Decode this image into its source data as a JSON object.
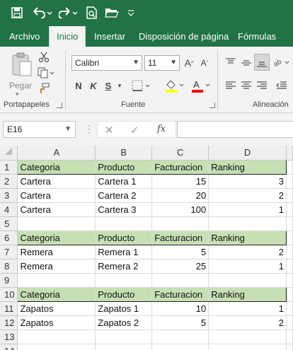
{
  "qat": {
    "icons": [
      "save-icon",
      "undo-icon",
      "redo-icon",
      "print-preview-icon",
      "open-folder-icon",
      "customize-qat-icon"
    ]
  },
  "tabs": [
    {
      "label": "Archivo"
    },
    {
      "label": "Inicio"
    },
    {
      "label": "Insertar"
    },
    {
      "label": "Disposición de página"
    },
    {
      "label": "Fórmulas"
    }
  ],
  "ribbon": {
    "clipboard": {
      "paste_label": "Pegar",
      "group_label": "Portapapeles"
    },
    "font": {
      "font_name": "Calibri",
      "font_size": "11",
      "bold": "N",
      "italic": "K",
      "underline": "S",
      "group_label": "Fuente",
      "highlight_color": "#ffff00",
      "font_color": "#ff0000"
    },
    "alignment": {
      "group_label": "Alineación"
    }
  },
  "formula_bar": {
    "name_box": "E16",
    "fx": "fx",
    "value": ""
  },
  "grid": {
    "columns": [
      "A",
      "B",
      "C",
      "D"
    ],
    "header_fill": "#c6e0b4",
    "rows": [
      {
        "n": "1",
        "cells": [
          "Categoria",
          "Producto",
          "Facturacion",
          "Ranking"
        ],
        "header": true
      },
      {
        "n": "2",
        "cells": [
          "Cartera",
          "Cartera 1",
          "15",
          "3"
        ]
      },
      {
        "n": "3",
        "cells": [
          "Cartera",
          "Cartera 2",
          "20",
          "2"
        ]
      },
      {
        "n": "4",
        "cells": [
          "Cartera",
          "Cartera 3",
          "100",
          "1"
        ]
      },
      {
        "n": "5",
        "cells": [
          "",
          "",
          "",
          ""
        ]
      },
      {
        "n": "6",
        "cells": [
          "Categoria",
          "Producto",
          "Facturacion",
          "Ranking"
        ],
        "header": true
      },
      {
        "n": "7",
        "cells": [
          "Remera",
          "Remera 1",
          "5",
          "2"
        ]
      },
      {
        "n": "8",
        "cells": [
          "Remera",
          "Remera 2",
          "25",
          "1"
        ]
      },
      {
        "n": "9",
        "cells": [
          "",
          "",
          "",
          ""
        ]
      },
      {
        "n": "10",
        "cells": [
          "Categoria",
          "Producto",
          "Facturacion",
          "Ranking"
        ],
        "header": true
      },
      {
        "n": "11",
        "cells": [
          "Zapatos",
          "Zapatos 1",
          "10",
          "1"
        ]
      },
      {
        "n": "12",
        "cells": [
          "Zapatos",
          "Zapatos 2",
          "5",
          "2"
        ]
      },
      {
        "n": "13",
        "cells": [
          "",
          "",
          "",
          ""
        ]
      },
      {
        "n": "14",
        "cells": [
          "",
          "",
          "",
          ""
        ]
      }
    ]
  }
}
